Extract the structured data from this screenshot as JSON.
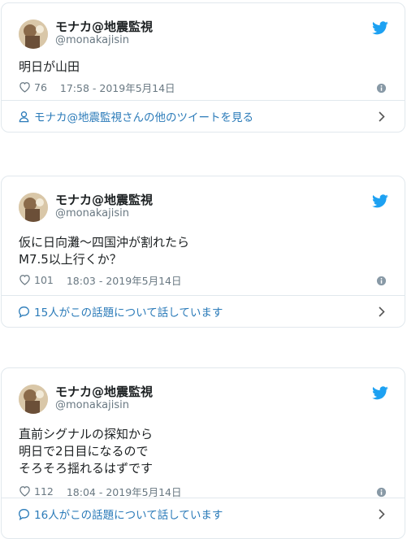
{
  "tweets": [
    {
      "name": "モナカ@地震監視",
      "handle": "@monakajisin",
      "lines": [
        "明日が山田"
      ],
      "likes": "76",
      "timestamp": "17:58 - 2019年5月14日",
      "footer": "モナカ@地震監視さんの他のツイートを見る",
      "footer_icon": "person-icon"
    },
    {
      "name": "モナカ@地震監視",
      "handle": "@monakajisin",
      "lines": [
        "仮に日向灘～四国沖が割れたら",
        "M7.5以上行くか？"
      ],
      "likes": "101",
      "timestamp": "18:03 - 2019年5月14日",
      "footer": "15人がこの話題について話しています",
      "footer_icon": "reply-bubble-icon"
    },
    {
      "name": "モナカ@地震監視",
      "handle": "@monakajisin",
      "lines": [
        "直前シグナルの探知から",
        "明日で2日目になるので",
        "そろそろ揺れるはずです"
      ],
      "likes": "112",
      "timestamp": "18:04 - 2019年5月14日",
      "footer": "16人がこの話題について話しています",
      "footer_icon": "reply-bubble-icon"
    }
  ],
  "colors": {
    "link": "#2b7bb9",
    "muted": "#697882",
    "twitter_blue": "#1da1f2",
    "border": "#e1e8ed"
  }
}
